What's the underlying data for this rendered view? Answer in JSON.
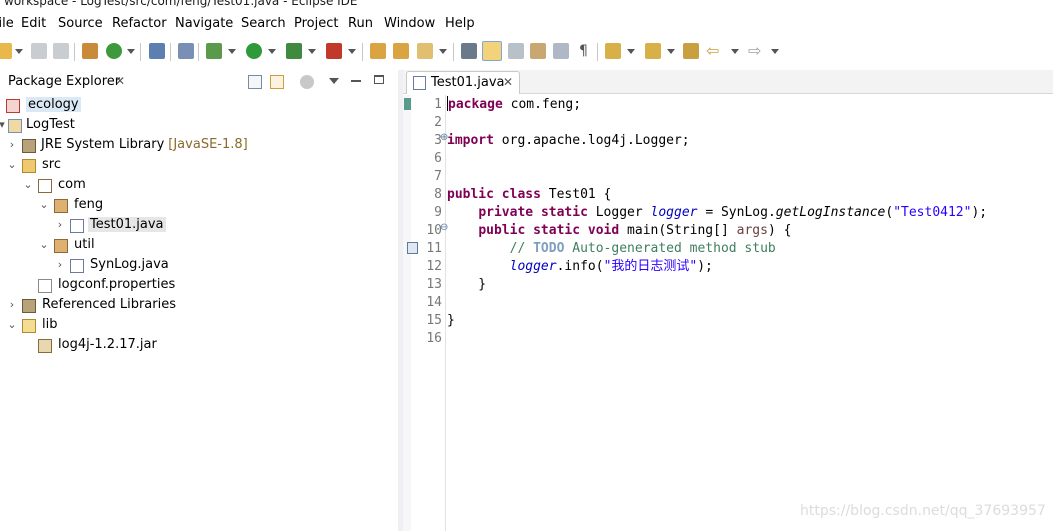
{
  "window": {
    "title": "workspace - LogTest/src/com/feng/Test01.java - Eclipse IDE"
  },
  "menu": {
    "items": [
      "File",
      "Edit",
      "Source",
      "Refactor",
      "Navigate",
      "Search",
      "Project",
      "Run",
      "Window",
      "Help"
    ]
  },
  "toolbar": {
    "icons": [
      "new-icon",
      "save-icon",
      "save-all-icon",
      "new-java-package-icon",
      "new-class-icon",
      "open-console-icon",
      "toggle-breakpoint-icon",
      "debug-icon",
      "run-icon",
      "coverage-icon",
      "external-tools-icon",
      "open-type-icon",
      "open-task-icon",
      "search-icon",
      "toggle-mark-occurrences-icon",
      "highlight-icon",
      "toggle-block-selection-icon",
      "show-whitespace-icon",
      "pilcrow-icon",
      "next-annotation-icon",
      "previous-annotation-icon",
      "last-edit-location-icon",
      "back-icon",
      "forward-icon"
    ]
  },
  "package_explorer": {
    "tab_label": "Package Explorer",
    "close_glyph": "✕",
    "tree": [
      {
        "label": "ecology",
        "icon": "java-project-error-icon"
      },
      {
        "label": "LogTest",
        "icon": "java-project-icon"
      },
      {
        "label": "JRE System Library",
        "decoration": "[JavaSE-1.8]",
        "icon": "library-icon"
      },
      {
        "label": "src",
        "icon": "source-folder-icon"
      },
      {
        "label": "com",
        "icon": "package-icon"
      },
      {
        "label": "feng",
        "icon": "package-icon"
      },
      {
        "label": "Test01.java",
        "icon": "java-file-icon"
      },
      {
        "label": "util",
        "icon": "package-icon"
      },
      {
        "label": "SynLog.java",
        "icon": "java-file-icon"
      },
      {
        "label": "logconf.properties",
        "icon": "properties-file-icon"
      },
      {
        "label": "Referenced Libraries",
        "icon": "library-icon"
      },
      {
        "label": "lib",
        "icon": "folder-icon"
      },
      {
        "label": "log4j-1.2.17.jar",
        "icon": "jar-file-icon"
      }
    ]
  },
  "editor": {
    "tab_label": "Test01.java",
    "close_glyph": "✕",
    "line_numbers": [
      "1",
      "2",
      "3",
      "6",
      "7",
      "8",
      "9",
      "10",
      "11",
      "12",
      "13",
      "14",
      "15",
      "16"
    ],
    "code": {
      "l1_kw": "package",
      "l1_rest": " com.feng;",
      "l3_kw": "import",
      "l3_rest": " org.apache.log4j.Logger;",
      "l8_kw1": "public",
      "l8_kw2": "class",
      "l8_rest": " Test01 {",
      "l9_indent": "    ",
      "l9_kw1": "private",
      "l9_kw2": "static",
      "l9_type": " Logger ",
      "l9_field": "logger",
      "l9_mid": " = SynLog.",
      "l9_method": "getLogInstance",
      "l9_open": "(",
      "l9_str": "\"Test0412\"",
      "l9_close": ");",
      "l10_indent": "    ",
      "l10_kw1": "public",
      "l10_kw2": "static",
      "l10_kw3": "void",
      "l10_mid": " main(String[] ",
      "l10_param": "args",
      "l10_close": ") {",
      "l11_indent": "        ",
      "l11_cmt1": "// ",
      "l11_todo": "TODO",
      "l11_cmt2": " Auto-generated method stub",
      "l12_indent": "        ",
      "l12_field": "logger",
      "l12_mid": ".info(",
      "l12_str": "\"我的日志测试\"",
      "l12_close": ");",
      "l13": "    }",
      "l15": "}"
    }
  },
  "watermark": "https://blog.csdn.net/qq_37693957",
  "colors": {
    "keyword": "#7f0055",
    "field": "#0000c0",
    "string": "#2a00ff",
    "comment": "#3f7f5f",
    "selection": "#dbe8f5"
  }
}
